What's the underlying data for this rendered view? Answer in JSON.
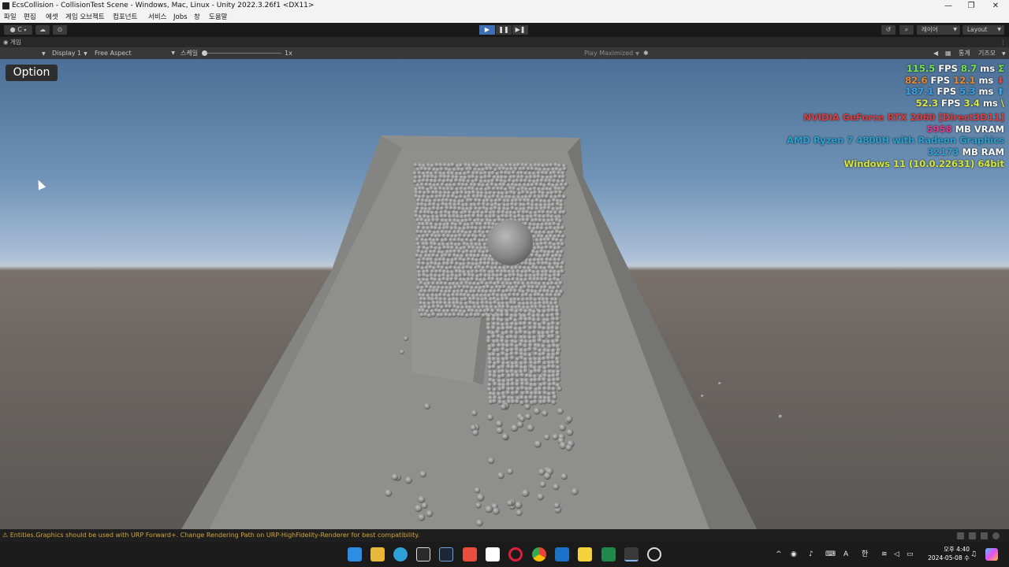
{
  "window": {
    "title": "EcsCollision - CollisionTest Scene - Windows, Mac, Linux - Unity 2022.3.26f1 <DX11>",
    "minimize": "—",
    "maximize": "❐",
    "close": "✕"
  },
  "menu": [
    "파일",
    "편집",
    "에셋",
    "게임 오브젝트",
    "컴포넌트",
    "서비스",
    "Jobs",
    "창",
    "도움말"
  ],
  "toolbar": {
    "account": "C",
    "play": "▶",
    "pause": "❚❚",
    "step": "▶❚",
    "layers_label": "레이어",
    "layout_label": "Layout"
  },
  "game_tab": {
    "label": "게임",
    "menu": "⋮"
  },
  "game_controls": {
    "display": "Display 1",
    "aspect": "Free Aspect",
    "scale_label": "스케일",
    "scale_value": "1x",
    "play_mode": "Play Maximized",
    "stats_label": "통계",
    "gizmos_label": "기즈모"
  },
  "overlay": {
    "option_button": "Option"
  },
  "stats": {
    "rows": [
      {
        "v1": "115.5",
        "u1": "FPS",
        "v2": "8.7",
        "u2": "ms",
        "s": "Σ"
      },
      {
        "v1": "82.6",
        "u1": "FPS",
        "v2": "12.1",
        "u2": "ms",
        "s": "⬇"
      },
      {
        "v1": "187.1",
        "u1": "FPS",
        "v2": "5.3",
        "u2": "ms",
        "s": "⬆"
      },
      {
        "v1": "52.3",
        "u1": "FPS",
        "v2": "3.4",
        "u2": "ms",
        "s": "\\"
      }
    ],
    "gpu": "NVIDIA GeForce RTX 2060 [Direct3D11]",
    "vram_value": "5958",
    "vram_unit": "MB VRAM",
    "cpu": "AMD Ryzen 7 4800H with Radeon Graphics",
    "ram_value": "32173",
    "ram_unit": "MB RAM",
    "os": "Windows 11  (10.0.22631) 64bit"
  },
  "console": {
    "warning_icon": "⚠",
    "message": "Entities.Graphics should be used with URP Forward+. Change Rendering Path on URP-HighFidelity-Renderer for best compatibility."
  },
  "taskbar": {
    "icons": [
      "windows-start",
      "file-explorer",
      "copilot",
      "unity-hub",
      "steam",
      "git-app",
      "notion",
      "opera",
      "chrome",
      "outlook",
      "sticky-notes",
      "excel",
      "unity",
      "github"
    ],
    "tray_ime_a": "A",
    "tray_ime_han": "한",
    "clock_time": "오후 4:40",
    "clock_date": "2024-05-08 수"
  },
  "colors": {
    "fps_green": "#77e84c",
    "fps_orange": "#f08a2a",
    "fps_blue": "#36a5e8",
    "fps_yellow": "#e2e844",
    "gpu_red": "#e03a3a",
    "cpu_blue": "#27a2d2",
    "os_yellow": "#d8e83a",
    "warning": "#d2a53a"
  }
}
